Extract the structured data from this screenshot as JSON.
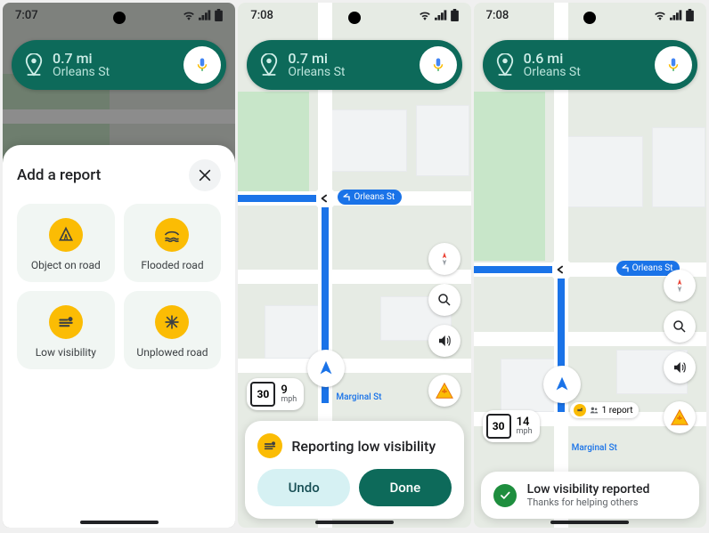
{
  "screen1": {
    "time": "7:07",
    "nav": {
      "distance": "0.7 mi",
      "street": "Orleans St"
    },
    "sheet": {
      "title": "Add a report",
      "options": [
        {
          "icon": "object-on-road-icon",
          "label": "Object on road"
        },
        {
          "icon": "flooded-road-icon",
          "label": "Flooded road"
        },
        {
          "icon": "low-visibility-icon",
          "label": "Low visibility"
        },
        {
          "icon": "unplowed-road-icon",
          "label": "Unplowed road"
        }
      ]
    }
  },
  "screen2": {
    "time": "7:08",
    "nav": {
      "distance": "0.7 mi",
      "street": "Orleans St"
    },
    "turn_label": "Orleans St",
    "road_label": "Marginal St",
    "speed": {
      "limit": "30",
      "current": "9",
      "unit": "mph"
    },
    "confirm": {
      "title": "Reporting low visibility",
      "undo": "Undo",
      "done": "Done"
    }
  },
  "screen3": {
    "time": "7:08",
    "nav": {
      "distance": "0.6 mi",
      "street": "Orleans St"
    },
    "turn_label": "Orleans St",
    "road_label": "Marginal St",
    "speed": {
      "limit": "30",
      "current": "14",
      "unit": "mph"
    },
    "report_pill": "1 report",
    "toast": {
      "title": "Low visibility reported",
      "sub": "Thanks for helping others"
    }
  }
}
